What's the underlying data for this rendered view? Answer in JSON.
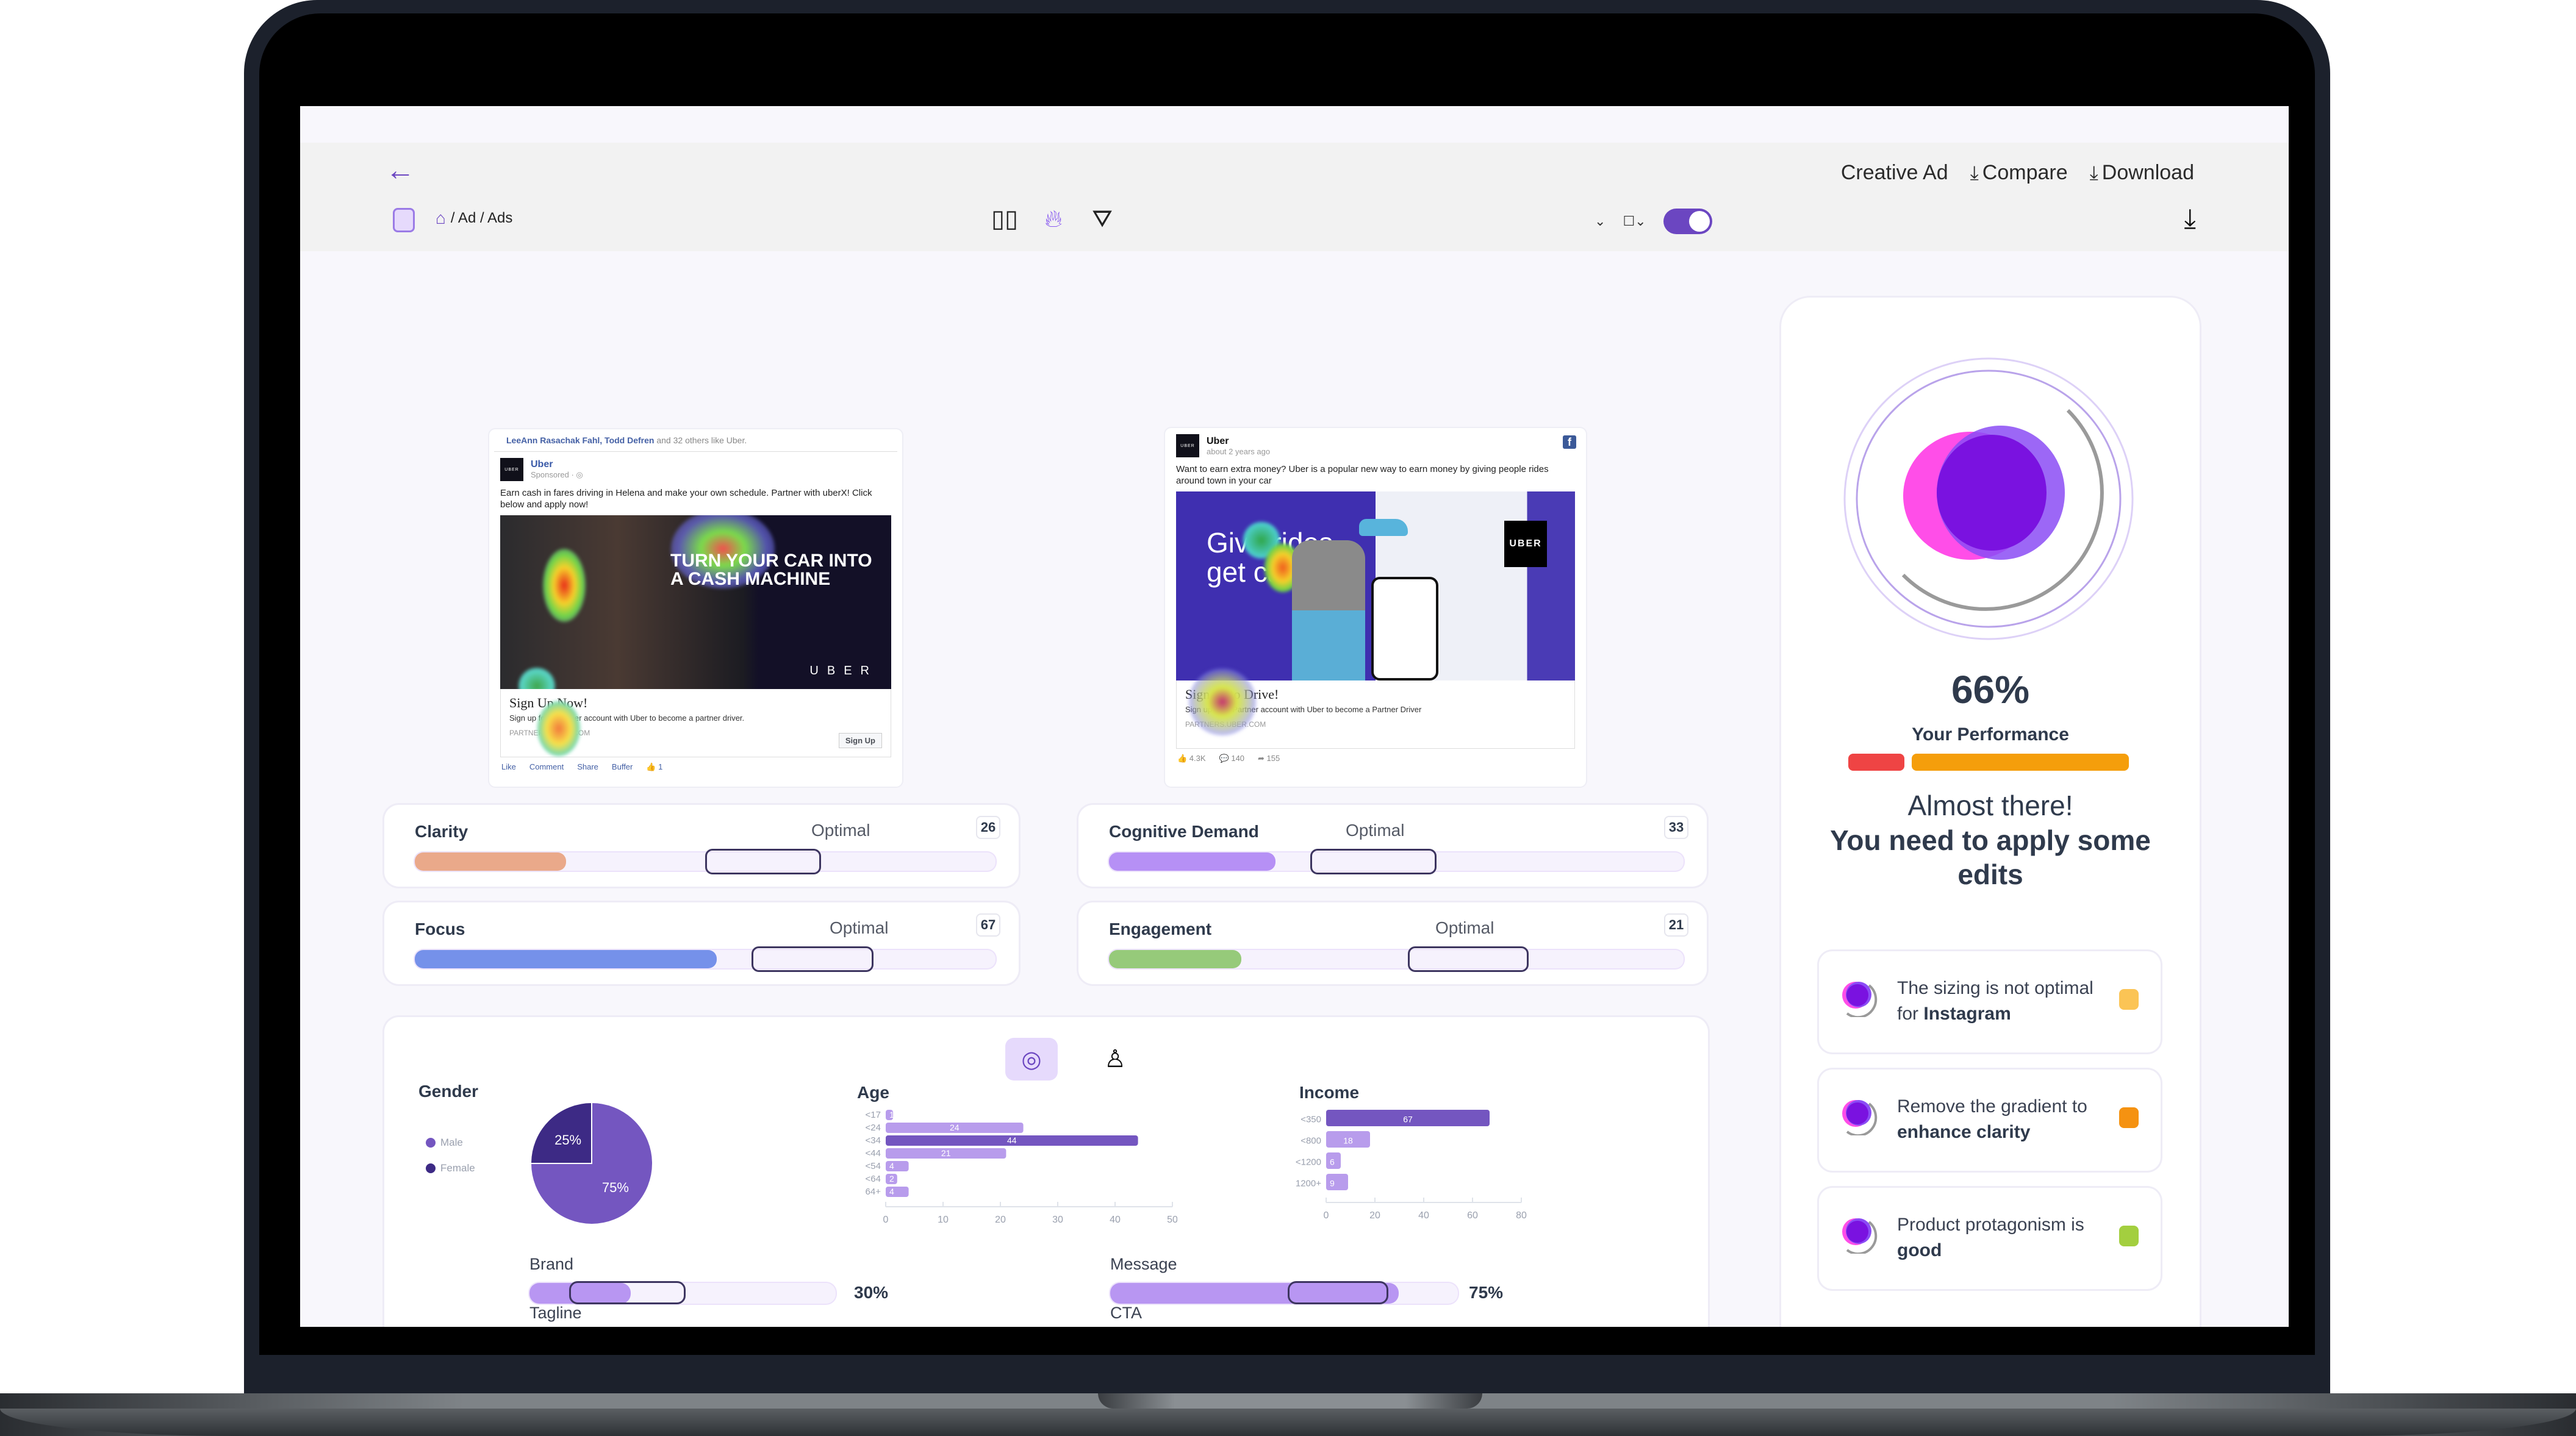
{
  "header": {
    "back_label": "←",
    "breadcrumb": "/ Ad / Ads",
    "actions": [
      {
        "label": "Creative Ad",
        "icon": ""
      },
      {
        "label": "Compare",
        "icon": "download-icon"
      },
      {
        "label": "Download",
        "icon": "download-icon"
      }
    ],
    "toolbar_icons": [
      "grid-icon",
      "heatmap-flame-icon",
      "filter-icon"
    ],
    "toggle_on": true
  },
  "ads": [
    {
      "likes_names": "LeeAnn Rasachak Fahl, Todd Defren",
      "likes_rest": " and 32 others like Uber.",
      "brand": "Uber",
      "sub": "Sponsored · ◎",
      "logo_text": "UBER",
      "text": "Earn cash in fares driving in Helena and make your own schedule. Partner with uberX! Click below and apply now!",
      "headline": "TURN YOUR CAR INTO A CASH MACHINE",
      "brandmark": "UBER",
      "cta_title": "Sign Up Now!",
      "cta_desc": "Sign up for a partner account with Uber to become a partner driver.",
      "cta_url": "PARTNERS.UBER.COM",
      "cta_button": "Sign Up",
      "footer": [
        "Like",
        "Comment",
        "Share",
        "Buffer",
        "👍 1"
      ]
    },
    {
      "brand": "Uber",
      "sub": "about 2 years ago",
      "logo_text": "UBER",
      "text": "Want to earn extra money? Uber is a popular new way to earn money by giving people rides around town in your car",
      "headline": "Give rides, get cash",
      "brandmark": "UBER",
      "cta_title": "Sign up to Drive!",
      "cta_desc": "Sign up for a Partner account with Uber to become a Partner Driver",
      "cta_url": "PARTNERS.UBER.COM",
      "footer": [
        "👍 4.3K",
        "💬 140",
        "➦ 155"
      ]
    }
  ],
  "metrics": [
    {
      "label": "Clarity",
      "optimal_label": "Optimal",
      "value": "26",
      "fill_pct": 26,
      "optimal_range": [
        50,
        70
      ],
      "color": "#eaa98a"
    },
    {
      "label": "Cognitive Demand",
      "optimal_label": "Optimal",
      "value": "33",
      "fill_pct": 29,
      "optimal_range": [
        35,
        57
      ],
      "color": "#b690f5"
    },
    {
      "label": "Focus",
      "optimal_label": "Optimal",
      "value": "67",
      "fill_pct": 52,
      "optimal_range": [
        58,
        79
      ],
      "color": "#7591ea"
    },
    {
      "label": "Engagement",
      "optimal_label": "Optimal",
      "value": "21",
      "fill_pct": 23,
      "optimal_range": [
        52,
        73
      ],
      "color": "#96ca7a"
    }
  ],
  "audience": {
    "tabs": [
      "eye-scan-icon",
      "person-icon"
    ],
    "brand": {
      "label": "Brand",
      "value": "30%",
      "fill_pct": 33,
      "window": [
        13,
        51
      ]
    },
    "message": {
      "label": "Message",
      "value": "75%",
      "fill_pct": 83,
      "window": [
        51,
        80
      ]
    },
    "tagline_label": "Tagline",
    "cta_label": "CTA"
  },
  "chart_data": [
    {
      "type": "pie",
      "title": "Gender",
      "categories": [
        "Male",
        "Female"
      ],
      "values": [
        75,
        25
      ],
      "labels": [
        "75%",
        "25%"
      ],
      "colors": [
        "#7456c0",
        "#3d2a85"
      ],
      "legend": "left"
    },
    {
      "type": "bar",
      "orientation": "horizontal",
      "title": "Age",
      "categories": [
        "<17",
        "<24",
        "<34",
        "<44",
        "<54",
        "<64",
        "64+"
      ],
      "values": [
        1,
        24,
        44,
        21,
        4,
        2,
        4
      ],
      "xticks": [
        0,
        10,
        20,
        30,
        40,
        50
      ],
      "xlim": [
        0,
        50
      ],
      "highlight_index": 2
    },
    {
      "type": "bar",
      "orientation": "horizontal",
      "title": "Income",
      "categories": [
        "<350",
        "<800",
        "<1200",
        "1200+"
      ],
      "values": [
        67,
        18,
        6,
        9
      ],
      "xticks": [
        0,
        20,
        40,
        60,
        80
      ],
      "xlim": [
        0,
        80
      ],
      "highlight_index": 0
    }
  ],
  "performance": {
    "score": "66%",
    "score_value": 66,
    "label": "Your Performance",
    "msg1": "Almost there!",
    "msg2": "You need to apply some edits",
    "recommendations": [
      {
        "text": "The sizing is not optimal for ",
        "bold": "Instagram",
        "color": "#fbc455"
      },
      {
        "text": "Remove the gradient to ",
        "bold": "enhance clarity",
        "color": "#f59211"
      },
      {
        "text": "Product protagonism is ",
        "bold": "good",
        "color": "#a3cf3f"
      }
    ]
  },
  "colors": {
    "accent": "#6b46c1",
    "bar_light": "#b89cec",
    "bar_dark": "#7456c0"
  }
}
